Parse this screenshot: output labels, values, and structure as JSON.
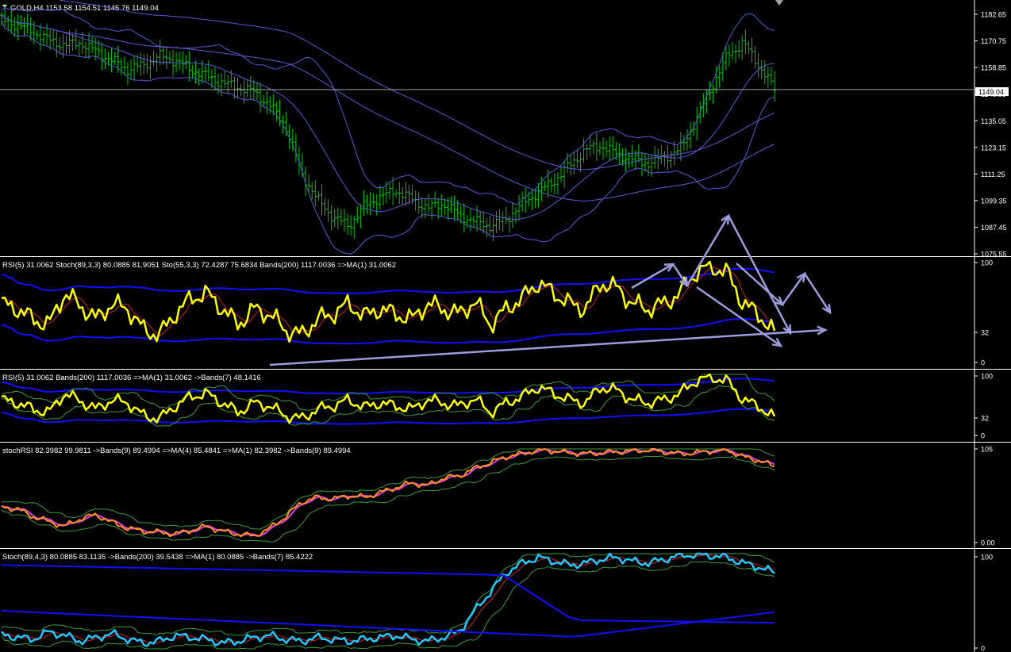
{
  "header": {
    "symbol_line": "GOLD,H4  1153.58 1154.51 1145.76 1149.04"
  },
  "colors": {
    "background": "#000000",
    "candle": "#00c800",
    "bands": "#5a5ad6",
    "rsi": "#ffff00",
    "ma_blue": "#1010ff",
    "arrow": "#9c9cdc",
    "stochrsi": "#ff9020",
    "stoch_cyan": "#20c8ff",
    "thin_green": "#3c9c3c",
    "thin_red": "#d02020",
    "magenta": "#e040e0"
  },
  "panels": [
    {
      "id": "price",
      "header": "",
      "axis_ticks": [
        "1182.65",
        "1170.75",
        "1158.85",
        "1146.95",
        "1135.05",
        "1123.15",
        "1111.25",
        "1099.35",
        "1087.45",
        "1075.55"
      ],
      "current_price": "1149.04"
    },
    {
      "id": "rsi_stoch",
      "header": "RSI(5) 31.0062  Stoch(89,3,3) 80.0885 81.9051  Sto(55,3,3) 72.4287 75.6834  Bands(200) 1117.0036  =>MA(1) 31.0062",
      "axis_ticks": [
        "100",
        "32",
        "0"
      ]
    },
    {
      "id": "rsi_bands",
      "header": "RSI(5) 31.0062  Bands(200) 1117.0036  =>MA(1) 31.0062  ->Bands(7) 48.1416",
      "axis_ticks": [
        "100",
        "32",
        "0"
      ]
    },
    {
      "id": "stochrsi",
      "header": "stochRSI 82.3982 99.9811  ->Bands(9) 89.4994  =>MA(4) 85.4841  =>MA(1) 82.3982  ->Bands(9) 89.4994",
      "axis_ticks": [
        "105",
        "0.00"
      ]
    },
    {
      "id": "stoch",
      "header": "Stoch(89,4,3) 80.0885 83.1135  ->Bands(200) 39.5438  =>MA(1) 80.0885  ->Bands(7) 85.4222",
      "axis_ticks": [
        "100",
        "0"
      ]
    }
  ],
  "chart_data": [
    {
      "type": "line",
      "title": "GOLD,H4",
      "series": [
        {
          "values": [
            1180,
            1178,
            1175,
            1171,
            1169,
            1170,
            1166,
            1162,
            1158,
            1160,
            1164,
            1162,
            1158,
            1155,
            1152,
            1150,
            1148,
            1142,
            1133,
            1112,
            1100,
            1092,
            1088,
            1097,
            1101,
            1104,
            1100,
            1096,
            1098,
            1093,
            1090,
            1088,
            1091,
            1098,
            1103,
            1108,
            1115,
            1122,
            1124,
            1120,
            1118,
            1116,
            1119,
            1122,
            1135,
            1150,
            1164,
            1170,
            1160,
            1149
          ]
        }
      ]
    },
    {
      "type": "line",
      "title": "RSI(5) 31.0062",
      "series": [
        {
          "values": [
            60,
            55,
            45,
            40,
            70,
            58,
            45,
            60,
            55,
            35,
            30,
            50,
            65,
            70,
            55,
            40,
            55,
            50,
            35,
            30,
            45,
            50,
            60,
            48,
            55,
            50,
            45,
            60,
            55,
            50,
            62,
            40,
            55,
            65,
            80,
            70,
            60,
            55,
            80,
            75,
            60,
            55,
            60,
            70,
            90,
            95,
            90,
            60,
            50,
            31
          ]
        }
      ]
    },
    {
      "type": "line",
      "title": "stochRSI 82.3982",
      "series": [
        {
          "values": [
            40,
            38,
            30,
            25,
            20,
            28,
            32,
            24,
            18,
            15,
            14,
            12,
            16,
            20,
            15,
            12,
            10,
            18,
            30,
            45,
            50,
            48,
            52,
            50,
            55,
            60,
            65,
            62,
            70,
            72,
            80,
            86,
            92,
            95,
            99,
            98,
            96,
            95,
            96,
            97,
            98,
            99,
            97,
            95,
            96,
            98,
            99,
            92,
            88,
            82
          ]
        }
      ]
    },
    {
      "type": "line",
      "title": "Stoch(89,4,3) 80.0885",
      "series": [
        {
          "values": [
            15,
            12,
            10,
            18,
            14,
            8,
            12,
            16,
            10,
            6,
            8,
            14,
            12,
            10,
            6,
            8,
            12,
            14,
            10,
            8,
            12,
            10,
            8,
            10,
            12,
            14,
            10,
            8,
            12,
            18,
            40,
            60,
            80,
            90,
            96,
            92,
            88,
            90,
            94,
            96,
            92,
            90,
            94,
            98,
            99,
            98,
            96,
            90,
            86,
            80
          ]
        }
      ]
    }
  ]
}
